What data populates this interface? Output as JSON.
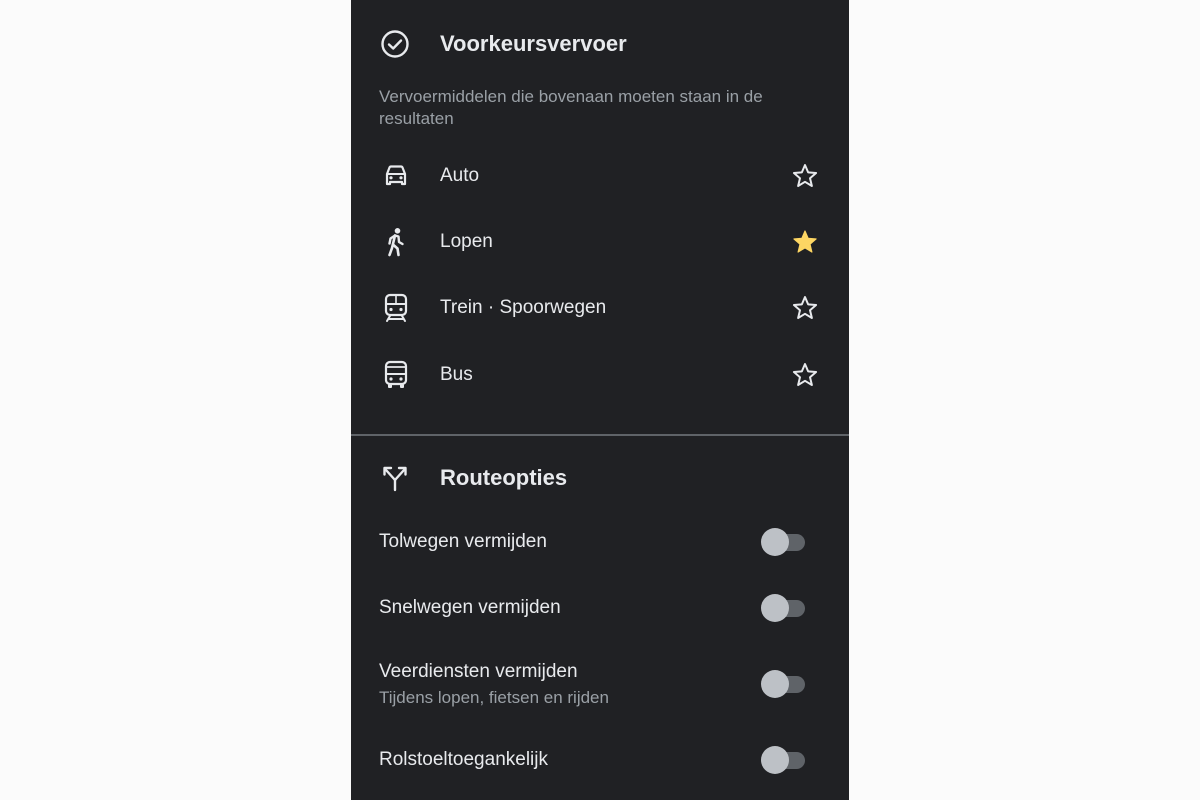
{
  "preferred": {
    "title": "Voorkeursvervoer",
    "subtitle": "Vervoermiddelen die bovenaan moeten staan in de resultaten",
    "modes": [
      {
        "label": "Auto",
        "icon": "car-icon",
        "favorite": false
      },
      {
        "label": "Lopen",
        "icon": "walk-icon",
        "favorite": true
      },
      {
        "label": "Trein · Spoorwegen",
        "icon": "train-icon",
        "favorite": false
      },
      {
        "label": "Bus",
        "icon": "bus-icon",
        "favorite": false
      }
    ]
  },
  "route_options": {
    "title": "Routeopties",
    "options": [
      {
        "label": "Tolwegen vermijden",
        "enabled": false
      },
      {
        "label": "Snelwegen vermijden",
        "enabled": false
      },
      {
        "label": "Veerdiensten vermijden",
        "sublabel": "Tijdens lopen, fietsen en rijden",
        "enabled": false
      },
      {
        "label": "Rolstoeltoegankelijk",
        "enabled": false
      }
    ]
  },
  "colors": {
    "background": "#202124",
    "star_active": "#fdd663",
    "toggle_off_track": "#5f6368",
    "toggle_off_thumb": "#bdc1c6"
  }
}
